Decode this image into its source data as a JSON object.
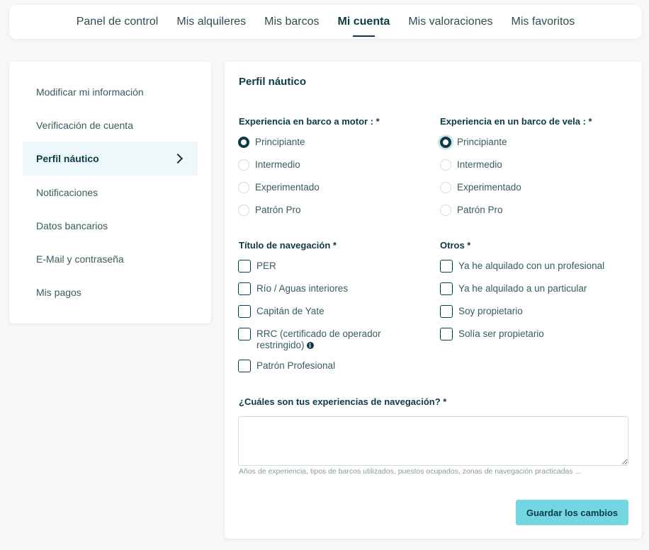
{
  "topnav": {
    "items": [
      "Panel de control",
      "Mis alquileres",
      "Mis barcos",
      "Mi cuenta",
      "Mis valoraciones",
      "Mis favoritos"
    ],
    "active": "Mi cuenta"
  },
  "sidebar": {
    "items": [
      "Modificar mi información",
      "Verificación de cuenta",
      "Perfil náutico",
      "Notificaciones",
      "Datos bancarios",
      "E-Mail y contraseña",
      "Mis pagos"
    ],
    "active": "Perfil náutico"
  },
  "panel": {
    "title": "Perfil náutico",
    "motor": {
      "label": "Experiencia en barco a motor : *",
      "options": [
        "Principiante",
        "Intermedio",
        "Experimentado",
        "Patrón Pro"
      ],
      "selected": "Principiante"
    },
    "sail": {
      "label": "Experiencia en un barco de vela : *",
      "options": [
        "Principiante",
        "Intermedio",
        "Experimentado",
        "Patrón Pro"
      ],
      "selected": "Principiante"
    },
    "license": {
      "label": "Título de navegación *",
      "options": [
        "PER",
        "Río / Aguas interiores",
        "Capitán de Yate",
        "RRC (certificado de operador restringido)",
        "Patrón Profesional"
      ]
    },
    "others": {
      "label": "Otros *",
      "options": [
        "Ya he alquilado con un profesional",
        "Ya he alquilado a un particular",
        "Soy propietario",
        "Solía ser propietario"
      ]
    },
    "experience": {
      "label": "¿Cuáles son tus experiencias de navegación? *",
      "value": "",
      "hint": "Años de experiencia, tipos de barcos utilizados, puestos ocupados, zonas de navegación practicadas ..."
    },
    "save_label": "Guardar los cambios",
    "info_icon": "info-icon"
  },
  "colors": {
    "primary": "#0c3b45",
    "accent": "#74d6e3",
    "active_bg": "#eef8fa"
  }
}
